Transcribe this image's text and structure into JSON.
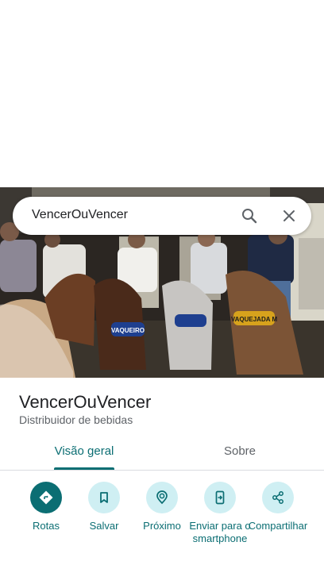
{
  "search": {
    "query": "VencerOuVencer"
  },
  "place": {
    "name": "VencerOuVencer",
    "category": "Distribuidor de bebidas",
    "photo_text": {
      "left": "VAQUEIRO",
      "right": "VAQUEJADA M"
    }
  },
  "tabs": [
    {
      "label": "Visão geral",
      "active": true
    },
    {
      "label": "Sobre",
      "active": false
    }
  ],
  "actions": [
    {
      "label": "Rotas",
      "icon": "directions-icon",
      "primary": true
    },
    {
      "label": "Salvar",
      "icon": "bookmark-icon",
      "primary": false
    },
    {
      "label": "Próximo",
      "icon": "nearby-icon",
      "primary": false
    },
    {
      "label": "Enviar para o smartphone",
      "icon": "send-to-phone-icon",
      "primary": false
    },
    {
      "label": "Compartilhar",
      "icon": "share-icon",
      "primary": false
    }
  ],
  "colors": {
    "accent": "#0b6e73",
    "action_bg": "#cfeff3",
    "divider": "#dadce0"
  }
}
